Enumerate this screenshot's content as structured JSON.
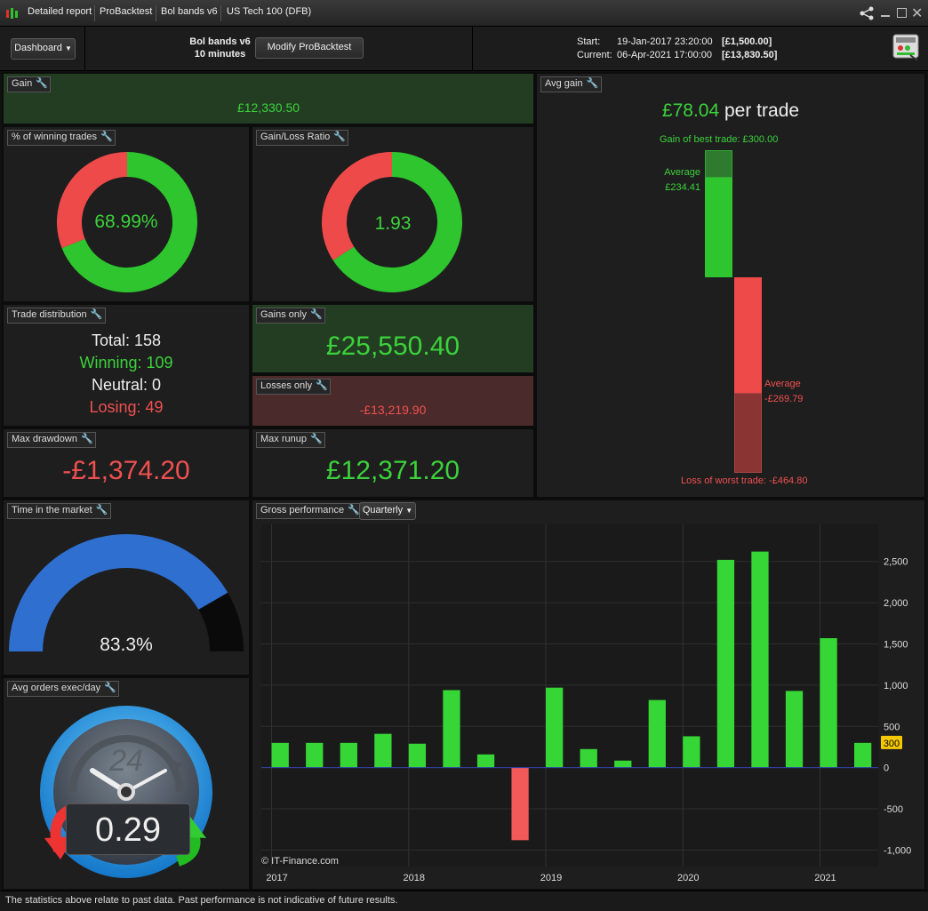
{
  "window": {
    "tabs": [
      "Detailed report",
      "ProBacktest",
      "Bol bands v6",
      "US Tech 100 (DFB)"
    ]
  },
  "toolbar": {
    "dashboard_label": "Dashboard",
    "strategy_name": "Bol bands v6",
    "timeframe": "10 minutes",
    "modify_button": "Modify ProBacktest",
    "start_label": "Start:",
    "start_date": "19-Jan-2017 23:20:00",
    "start_value": "[£1,500.00]",
    "current_label": "Current:",
    "current_date": "06-Apr-2021 17:00:00",
    "current_value": "[£13,830.50]"
  },
  "gain": {
    "title": "Gain",
    "value": "£12,330.50"
  },
  "win_pct": {
    "title": "% of winning trades",
    "value": "68.99%",
    "fraction": 0.6899
  },
  "gl_ratio": {
    "title": "Gain/Loss Ratio",
    "value": "1.93",
    "fraction": 0.6587
  },
  "distribution": {
    "title": "Trade distribution",
    "total": "Total: 158",
    "winning": "Winning: 109",
    "neutral": "Neutral: 0",
    "losing": "Losing: 49"
  },
  "gains_only": {
    "title": "Gains only",
    "value": "£25,550.40"
  },
  "losses_only": {
    "title": "Losses only",
    "value": "-£13,219.90"
  },
  "max_drawdown": {
    "title": "Max drawdown",
    "value": "-£1,374.20"
  },
  "max_runup": {
    "title": "Max runup",
    "value": "£12,371.20"
  },
  "avg_gain": {
    "title": "Avg gain",
    "value": "£78.04",
    "suffix": "per trade",
    "best_trade": "Gain of best trade: £300.00",
    "avg_win_label": "Average",
    "avg_win_value": "£234.41",
    "avg_loss_label": "Average",
    "avg_loss_value": "-£269.79",
    "worst_trade": "Loss of worst trade: -£464.80"
  },
  "time_in_market": {
    "title": "Time in the market",
    "value": "83.3%",
    "fraction": 0.833
  },
  "avg_orders": {
    "title": "Avg orders exec/day",
    "value": "0.29",
    "dial_label": "24"
  },
  "gross_perf": {
    "title": "Gross performance",
    "period": "Quarterly",
    "copyright": "© IT-Finance.com"
  },
  "chart_data": {
    "type": "bar",
    "title": "Gross performance",
    "x_labels": [
      "2017",
      "2018",
      "2019",
      "2020",
      "2021"
    ],
    "x_label_positions": [
      0,
      4,
      8,
      12,
      16
    ],
    "values": [
      300,
      300,
      300,
      410,
      290,
      940,
      160,
      -880,
      970,
      225,
      85,
      820,
      380,
      2520,
      2620,
      930,
      1570,
      300
    ],
    "y_ticks": [
      2500,
      2000,
      1500,
      1000,
      500,
      0,
      -500,
      -1000
    ],
    "y_tick_labels": [
      "2,500",
      "2,000",
      "1,500",
      "1,000",
      "500",
      "0",
      "-500",
      "-1,000"
    ],
    "ylim": [
      -1200,
      2950
    ],
    "last_value_badge": "300",
    "grid": true
  },
  "footer": {
    "text": "The statistics above relate to past data. Past performance is not indicative of future results."
  }
}
